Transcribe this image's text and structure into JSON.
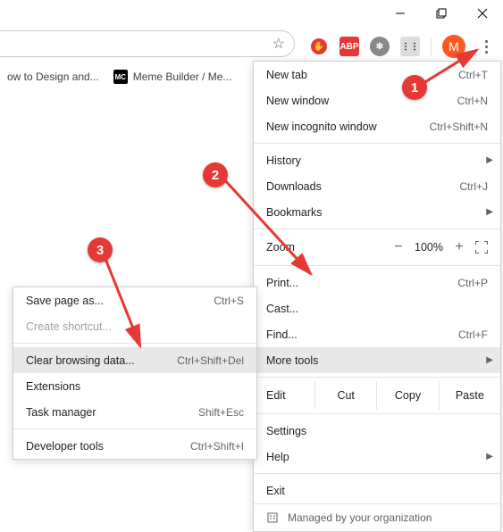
{
  "window": {
    "min": "Minimize",
    "max": "Maximize",
    "close": "Close"
  },
  "toolbar": {
    "star": "Bookmark",
    "ext1": "uBlock",
    "ext2": "ABP",
    "ext3": "Extension",
    "ext4": "Extension",
    "avatar_letter": "M"
  },
  "bookmarks": {
    "b1": {
      "label": "ow to Design and..."
    },
    "b2": {
      "favicon": "MC",
      "label": "Meme Builder / Me..."
    }
  },
  "menu": {
    "new_tab": {
      "label": "New tab",
      "shortcut": "Ctrl+T"
    },
    "new_window": {
      "label": "New window",
      "shortcut": "Ctrl+N"
    },
    "incognito": {
      "label": "New incognito window",
      "shortcut": "Ctrl+Shift+N"
    },
    "history": {
      "label": "History"
    },
    "downloads": {
      "label": "Downloads",
      "shortcut": "Ctrl+J"
    },
    "bookmarks": {
      "label": "Bookmarks"
    },
    "zoom": {
      "label": "Zoom",
      "value": "100%"
    },
    "print": {
      "label": "Print...",
      "shortcut": "Ctrl+P"
    },
    "cast": {
      "label": "Cast..."
    },
    "find": {
      "label": "Find...",
      "shortcut": "Ctrl+F"
    },
    "more_tools": {
      "label": "More tools"
    },
    "edit": {
      "label": "Edit",
      "cut": "Cut",
      "copy": "Copy",
      "paste": "Paste"
    },
    "settings": {
      "label": "Settings"
    },
    "help": {
      "label": "Help"
    },
    "exit": {
      "label": "Exit"
    },
    "managed": {
      "label": "Managed by your organization"
    }
  },
  "submenu": {
    "save_page": {
      "label": "Save page as...",
      "shortcut": "Ctrl+S"
    },
    "create_shortcut": {
      "label": "Create shortcut..."
    },
    "clear_data": {
      "label": "Clear browsing data...",
      "shortcut": "Ctrl+Shift+Del"
    },
    "extensions": {
      "label": "Extensions"
    },
    "task_manager": {
      "label": "Task manager",
      "shortcut": "Shift+Esc"
    },
    "dev_tools": {
      "label": "Developer tools",
      "shortcut": "Ctrl+Shift+I"
    }
  },
  "annotations": {
    "b1": "1",
    "b2": "2",
    "b3": "3"
  }
}
